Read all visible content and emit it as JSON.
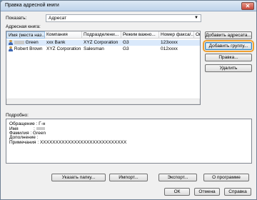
{
  "window": {
    "title": "Правка адресной книги"
  },
  "show": {
    "label": "Показать:",
    "value": "Адресат"
  },
  "addressbook_label": "Адресная книга:",
  "columns": [
    "Имя (места наз...",
    "Компания",
    "Подразделени...",
    "Режим важно...",
    "Номер факса/...",
    "Опи"
  ],
  "rows": [
    {
      "name_suffix": "Green",
      "company": "xxx Bank",
      "dept": "XYZ Corporation",
      "mode": "G3",
      "fax": "123xxxx"
    },
    {
      "name_suffix": "Robert Brown",
      "company": "XYZ Corporation",
      "dept": "Salesman",
      "mode": "G3",
      "fax": "012xxxx"
    }
  ],
  "side_buttons": {
    "add_recipient": "Добавить адресата...",
    "add_group": "Добавить группу...",
    "edit": "Правка...",
    "delete": "Удалить"
  },
  "details": {
    "label": "Подробно:",
    "lines": [
      "Обращение : Г-н",
      "Имя",
      "Фамилия : Green",
      "Дополнение :",
      "Примечания : XXXXXXXXXXXXXXXXXXXXXXXXXXXX"
    ],
    "name_value_redacted": ": "
  },
  "bottom_buttons": {
    "folder": "Указать папку...",
    "import": "Импорт...",
    "export": "Экспорт...",
    "about": "О программе"
  },
  "footer_buttons": {
    "ok": "ОК",
    "cancel": "Отмена",
    "help": "Справка"
  }
}
